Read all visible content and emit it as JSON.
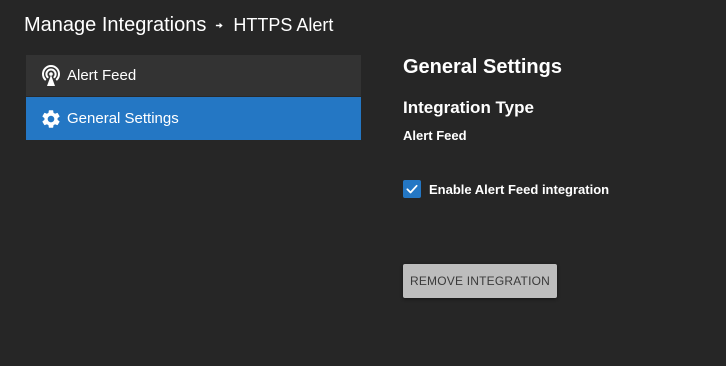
{
  "breadcrumb": {
    "root": "Manage Integrations",
    "separator_icon": "arrow-right-icon",
    "current": "HTTPS Alert"
  },
  "sidebar": {
    "items": [
      {
        "label": "Alert Feed",
        "icon": "antenna-icon",
        "active": false
      },
      {
        "label": "General Settings",
        "icon": "gear-icon",
        "active": true
      }
    ]
  },
  "main": {
    "title": "General Settings",
    "integration_type_heading": "Integration Type",
    "integration_type_value": "Alert Feed",
    "enable_checkbox": {
      "label": "Enable Alert Feed integration",
      "checked": true
    },
    "remove_button_label": "REMOVE INTEGRATION"
  },
  "colors": {
    "background": "#262626",
    "sidebar_item": "#333333",
    "accent": "#2477c4",
    "button": "#bdbdbd"
  }
}
